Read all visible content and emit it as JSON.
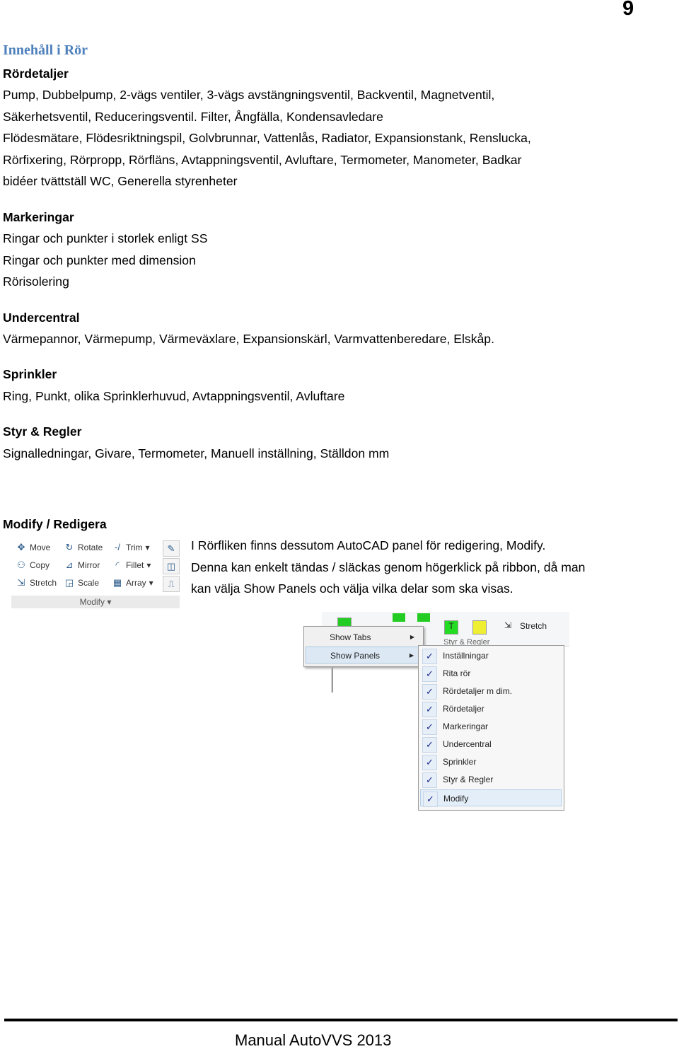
{
  "page_number": "9",
  "title": "Innehåll i Rör",
  "sections": [
    {
      "heading": "Rördetaljer",
      "lines": [
        "Pump, Dubbelpump, 2-vägs ventiler, 3-vägs avstängningsventil, Backventil, Magnetventil,",
        "Säkerhetsventil, Reduceringsventil. Filter, Ångfälla, Kondensavledare",
        "Flödesmätare, Flödesriktningspil, Golvbrunnar, Vattenlås, Radiator, Expansionstank, Renslucka,",
        "Rörfixering, Rörpropp, Rörfläns, Avtappningsventil, Avluftare, Termometer, Manometer, Badkar",
        "bidéer tvättställ WC, Generella styrenheter"
      ]
    },
    {
      "heading": "Markeringar",
      "lines": [
        "Ringar och punkter i storlek enligt SS",
        "Ringar och punkter med dimension",
        "Rörisolering"
      ]
    },
    {
      "heading": "Undercentral",
      "lines": [
        "Värmepannor, Värmepump, Värmeväxlare, Expansionskärl, Varmvattenberedare, Elskåp."
      ]
    },
    {
      "heading": "Sprinkler",
      "lines": [
        "Ring, Punkt, olika Sprinklerhuvud, Avtappningsventil, Avluftare"
      ]
    },
    {
      "heading": "Styr & Regler",
      "lines": [
        "Signalledningar, Givare, Termometer, Manuell inställning, Ställdon mm"
      ]
    }
  ],
  "modify_heading": "Modify / Redigera",
  "modify_panel": {
    "tools": [
      [
        "Move",
        "Rotate",
        "Trim"
      ],
      [
        "Copy",
        "Mirror",
        "Fillet"
      ],
      [
        "Stretch",
        "Scale",
        "Array"
      ]
    ],
    "footer": "Modify"
  },
  "modify_text": [
    "I Rörfliken finns dessutom AutoCAD panel för redigering, Modify.",
    "Denna kan enkelt tändas / släckas genom högerklick på ribbon, då man",
    "kan välja Show Panels och välja vilka delar som ska visas."
  ],
  "context_menu": {
    "items": [
      "Show Tabs",
      "Show Panels"
    ],
    "ribbon_labels": {
      "stretch": "Stretch",
      "panel": "Styr & Regler"
    },
    "panels": [
      "Inställningar",
      "Rita rör",
      "Rördetaljer m dim.",
      "Rördetaljer",
      "Markeringar",
      "Undercentral",
      "Sprinkler",
      "Styr & Regler",
      "Modify"
    ]
  },
  "footer": "Manual AutoVVS 2013",
  "colors": {
    "title": "#4f81bd"
  }
}
